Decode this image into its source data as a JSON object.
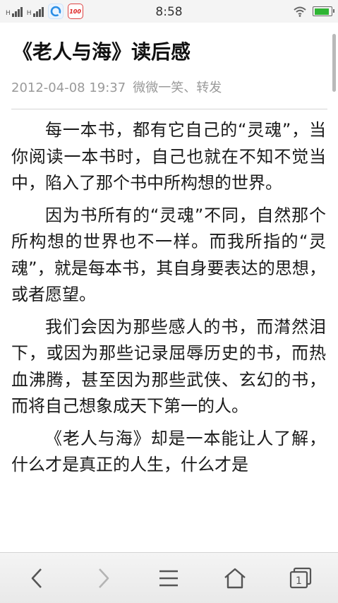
{
  "status_bar": {
    "time": "8:58",
    "signal_labels": [
      "H",
      "H"
    ],
    "apps": [
      "browser-app-icon",
      "100-app-icon"
    ],
    "app_100_label": "100",
    "battery_level": 0.9,
    "battery_color": "#2fb534"
  },
  "article": {
    "title": "《老人与海》读后感",
    "date": "2012-04-08 19:37",
    "source": "微微一笑、转发",
    "paragraphs": [
      "每一本书，都有它自己的“灵魂”，当你阅读一本书时，自己也就在不知不觉当中，陷入了那个书中所构想的世界。",
      "因为书所有的“灵魂”不同，自然那个所构想的世界也不一样。而我所指的“灵魂”，就是每本书，其自身要表达的思想，或者愿望。",
      "我们会因为那些感人的书，而潸然泪下，或因为那些记录屈辱历史的书，而热血沸腾，甚至因为那些武侠、玄幻的书，而将自己想象成天下第一的人。",
      "《老人与海》却是一本能让人了解，什么才是真正的人生，什么才是"
    ]
  },
  "toolbar": {
    "buttons": [
      "back-icon",
      "forward-icon",
      "menu-icon",
      "home-icon",
      "tabs-icon"
    ],
    "tab_count": "1"
  }
}
